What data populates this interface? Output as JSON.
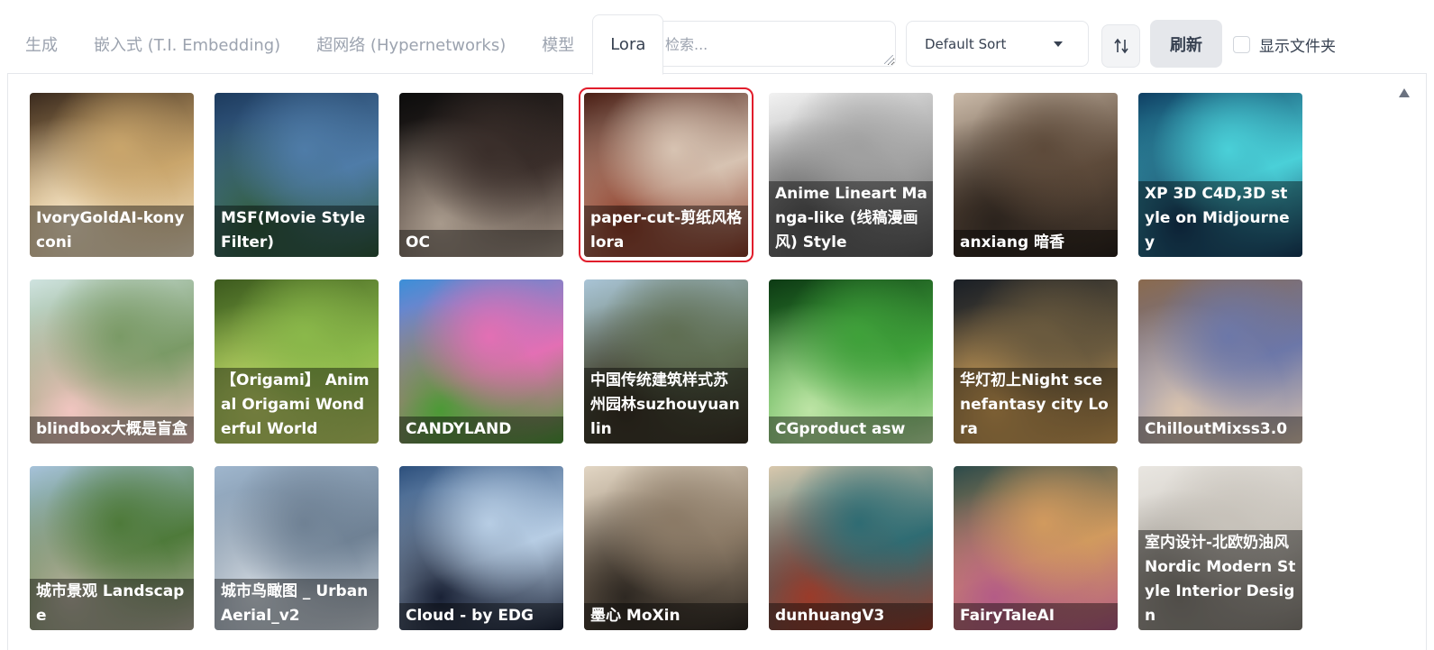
{
  "tabs": [
    {
      "label": "生成",
      "active": false
    },
    {
      "label": "嵌入式 (T.I. Embedding)",
      "active": false
    },
    {
      "label": "超网络 (Hypernetworks)",
      "active": false
    },
    {
      "label": "模型",
      "active": false
    },
    {
      "label": "Lora",
      "active": true
    }
  ],
  "search": {
    "placeholder": "检索...",
    "value": ""
  },
  "sort": {
    "selected": "Default Sort"
  },
  "sort_toggle_icon": "up-down-arrows-icon",
  "refresh_label": "刷新",
  "show_dirs": {
    "label": "显示文件夹",
    "checked": false
  },
  "cards": [
    {
      "name": "IvoryGoldAI-konyconi",
      "bg": [
        "#3a2a1e",
        "#c9a56b",
        "#f3e3c6"
      ],
      "selected": false
    },
    {
      "name": "MSF(Movie Style Filter)",
      "bg": [
        "#1d3b5e",
        "#4f7ca8",
        "#2f5a3a"
      ],
      "selected": false
    },
    {
      "name": "OC",
      "bg": [
        "#0c0c0c",
        "#3a2e2a",
        "#a89a8c"
      ],
      "selected": false
    },
    {
      "name": "paper-cut-剪纸风格lora",
      "bg": [
        "#4a1e14",
        "#d7c3b2",
        "#8b3a26"
      ],
      "selected": true
    },
    {
      "name": "Anime Lineart Manga-like (线稿漫画风) Style",
      "bg": [
        "#f2f2f2",
        "#a0a0a0",
        "#595959"
      ],
      "selected": false
    },
    {
      "name": "anxiang 暗香",
      "bg": [
        "#c9b9a8",
        "#5d4a3a",
        "#2b231d"
      ],
      "selected": false
    },
    {
      "name": "XP 3D C4D,3D style on Midjourney",
      "bg": [
        "#0f3f63",
        "#4ad0d8",
        "#163a5c"
      ],
      "selected": false
    },
    {
      "name": "blindbox大概是盲盒",
      "bg": [
        "#cfe3e0",
        "#7a9a66",
        "#f0c5c0"
      ],
      "selected": false
    },
    {
      "name": "【Origami】 Animal Origami Wonderful World",
      "bg": [
        "#3d5a1e",
        "#8ab84a",
        "#c4d66a"
      ],
      "selected": false
    },
    {
      "name": "CANDYLAND",
      "bg": [
        "#3b8fd8",
        "#e36fb4",
        "#4c9a36"
      ],
      "selected": false
    },
    {
      "name": "中国传统建筑样式苏州园林suzhouyuanlin",
      "bg": [
        "#a9c4d6",
        "#5f6e52",
        "#3a3226"
      ],
      "selected": false
    },
    {
      "name": "CGproduct asw",
      "bg": [
        "#0d3a14",
        "#3fa13a",
        "#bde4a5"
      ],
      "selected": false
    },
    {
      "name": "华灯初上Night scenefantasy city Lora",
      "bg": [
        "#1a1f26",
        "#6a5a3e",
        "#d6a45a"
      ],
      "selected": false
    },
    {
      "name": "ChilloutMixss3.0",
      "bg": [
        "#8a6a4e",
        "#6c77a8",
        "#d9c3ae"
      ],
      "selected": false
    },
    {
      "name": "城市景观 Landscape",
      "bg": [
        "#a6c2da",
        "#4e7a3a",
        "#b8b2a2"
      ],
      "selected": false
    },
    {
      "name": "城市鸟瞰图 _ UrbanAerial_v2",
      "bg": [
        "#9fb6cd",
        "#6f8194",
        "#d5dde5"
      ],
      "selected": false
    },
    {
      "name": "Cloud - by EDG",
      "bg": [
        "#2c4f7c",
        "#b7cde4",
        "#1a2236"
      ],
      "selected": false
    },
    {
      "name": "墨心 MoXin",
      "bg": [
        "#e2d6c4",
        "#8b7a66",
        "#2e2822"
      ],
      "selected": false
    },
    {
      "name": "dunhuangV3",
      "bg": [
        "#d9c8ad",
        "#2f6c73",
        "#9a3b2a"
      ],
      "selected": false
    },
    {
      "name": "FairyTaleAI",
      "bg": [
        "#2c4a4a",
        "#d19a5e",
        "#b45c86"
      ],
      "selected": false
    },
    {
      "name": "室内设计-北欧奶油风Nordic Modern Style Interior Design",
      "bg": [
        "#e9e6e1",
        "#c7c2ba",
        "#8a857d"
      ],
      "selected": false
    }
  ]
}
